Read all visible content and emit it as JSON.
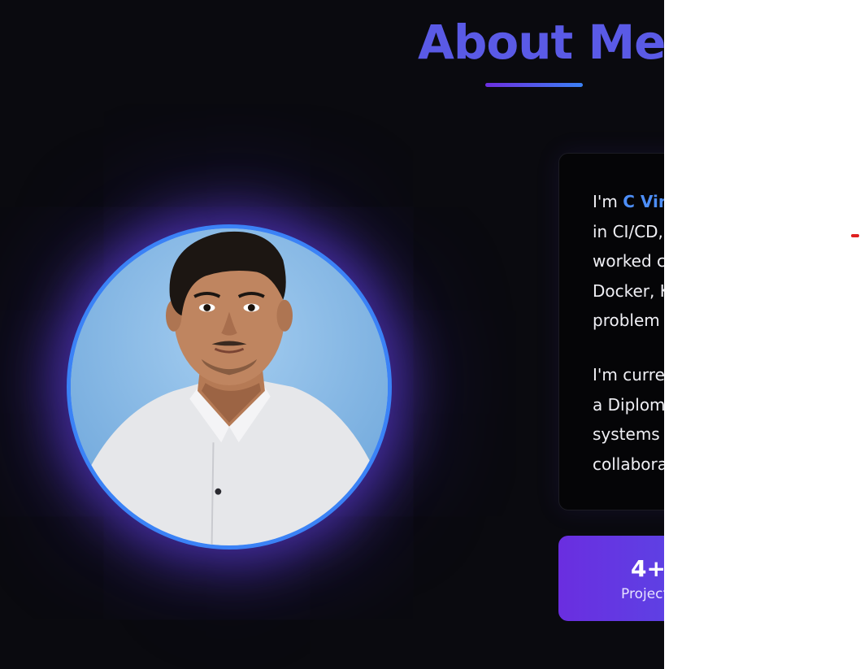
{
  "about": {
    "title": "About Me",
    "bio": {
      "intro_prefix": "I'm ",
      "name_highlight": "C Vin",
      "p1_lines": [
        "in CI/CD,",
        "worked c",
        "Docker, K",
        "problem"
      ],
      "p2_lines": [
        "I'm curre",
        "a Diplom",
        "systems t",
        "collabora"
      ]
    },
    "stats": [
      {
        "value": "4+",
        "label": "Project"
      }
    ],
    "profile_photo": {
      "alt": "profile photo"
    }
  },
  "colors": {
    "background": "#0a0a0f",
    "title": "#5a5ae6",
    "accent_blue": "#3b82f6",
    "accent_purple": "#6a2ee0",
    "highlight": "#4d8ef7"
  }
}
